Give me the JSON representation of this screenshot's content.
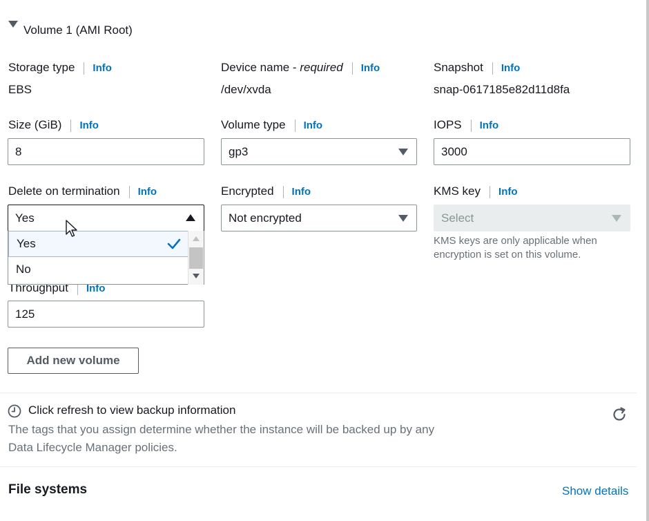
{
  "volume": {
    "title": "Volume 1 (AMI Root)",
    "info_label": "Info",
    "storage_type": {
      "label": "Storage type",
      "value": "EBS"
    },
    "device_name": {
      "label": "Device name - ",
      "label_emphasis": "required",
      "value": "/dev/xvda"
    },
    "snapshot": {
      "label": "Snapshot",
      "value": "snap-0617185e82d11d8fa"
    },
    "size": {
      "label": "Size (GiB)",
      "value": "8"
    },
    "volume_type": {
      "label": "Volume type",
      "value": "gp3"
    },
    "iops": {
      "label": "IOPS",
      "value": "3000"
    },
    "delete_on_termination": {
      "label": "Delete on termination",
      "value": "Yes",
      "options": [
        "Yes",
        "No"
      ],
      "selected": "Yes"
    },
    "encrypted": {
      "label": "Encrypted",
      "value": "Not encrypted"
    },
    "kms_key": {
      "label": "KMS key",
      "placeholder": "Select",
      "help_line1": "KMS keys are only applicable when",
      "help_line2": "encryption is set on this volume."
    },
    "throughput": {
      "label": "Throughput",
      "value": "125"
    }
  },
  "add_volume_button": "Add new volume",
  "backup": {
    "title": "Click refresh to view backup information",
    "line1": "The tags that you assign determine whether the instance will be backed up by any",
    "line2": "Data Lifecycle Manager policies."
  },
  "file_systems": {
    "title": "File systems",
    "link": "Show details"
  },
  "colors": {
    "link": "#0073bb",
    "text": "#16191f",
    "muted": "#687078",
    "border": "#879596"
  },
  "icons": [
    "caret-down-icon",
    "clock-icon",
    "refresh-icon",
    "checkmark-icon",
    "cursor-icon"
  ]
}
